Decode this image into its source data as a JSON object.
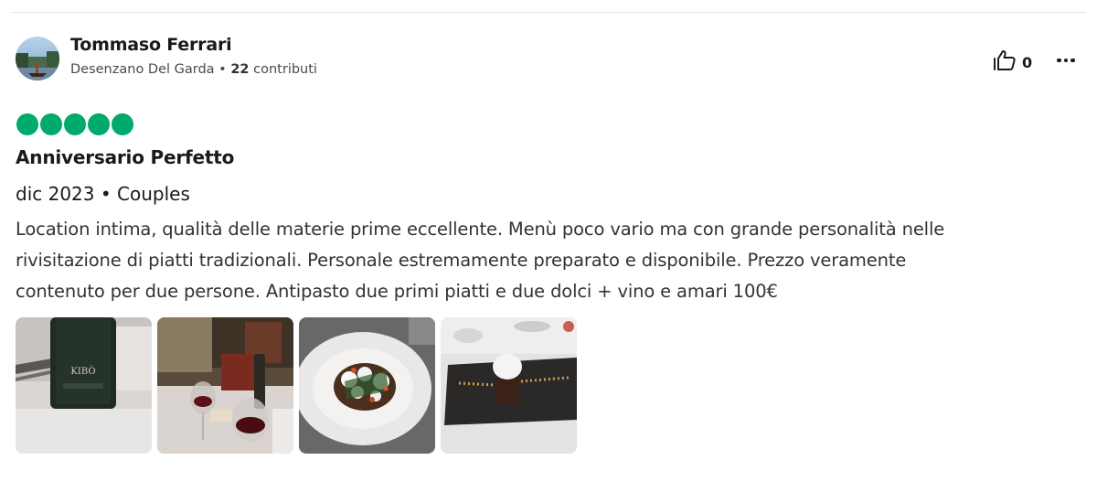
{
  "author": {
    "name": "Tommaso Ferrari",
    "location": "Desenzano Del Garda",
    "separator": " • ",
    "contributions_count": "22",
    "contributions_label": " contributi"
  },
  "actions": {
    "like_count": "0",
    "like_icon": "thumbs-up-icon",
    "more_icon": "more-horizontal-icon"
  },
  "rating": {
    "value": 5,
    "max": 5,
    "color": "#00aa6c"
  },
  "review": {
    "title": "Anniversario Perfetto",
    "date_line": "dic 2023 • Couples",
    "lines": [
      "Location intima, qualità delle materie prime eccellente. Menù poco vario ma con grande personalità nelle",
      "rivisitazione di piatti tradizionali. Personale estremamente preparato e disponibile. Prezzo veramente",
      "contenuto per due persone. Antipasto due primi piatti e due dolci + vino e amari 100€"
    ]
  },
  "photos": [
    {
      "subject": "wine-bottle-photo"
    },
    {
      "subject": "table-wine-glasses-photo"
    },
    {
      "subject": "plated-dish-photo"
    },
    {
      "subject": "dessert-slate-photo"
    }
  ]
}
